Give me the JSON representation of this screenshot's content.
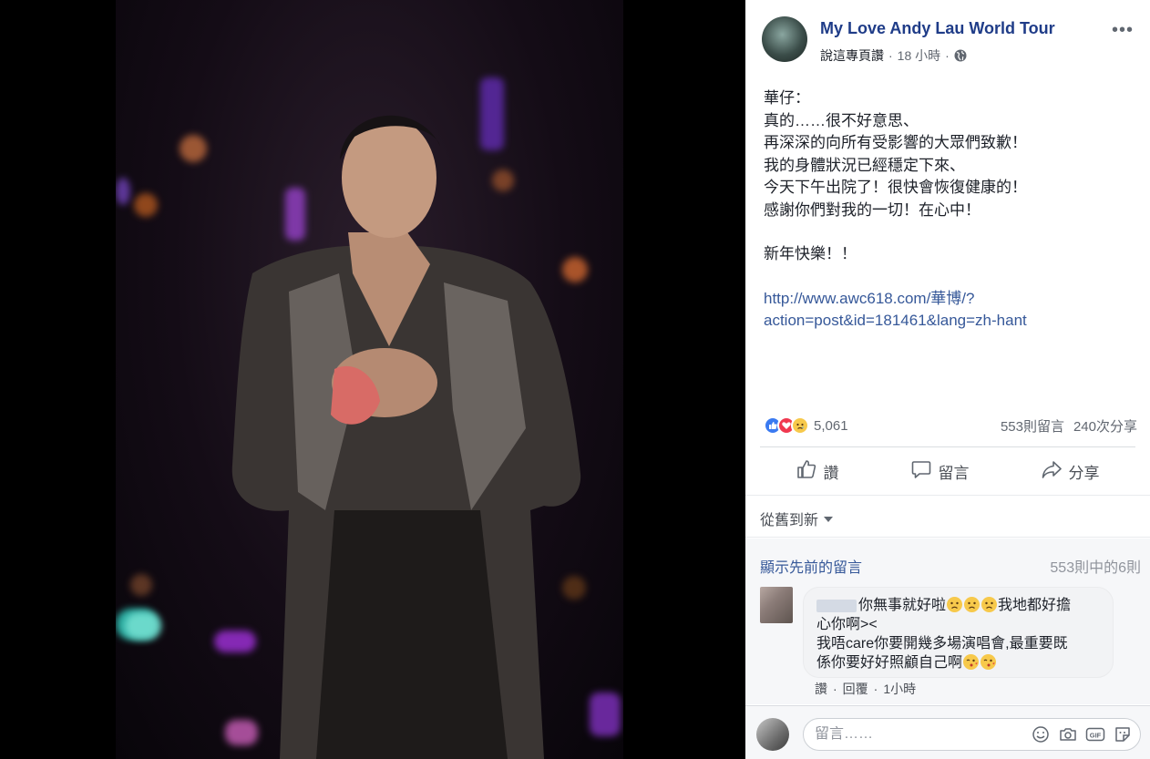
{
  "post": {
    "page_name": "My Love Andy Lau World Tour",
    "say_link": "說這專頁讚",
    "dot": "·",
    "time": "18 小時",
    "more": "•••",
    "lines": [
      "華仔：",
      "真的……很不好意思、",
      "再深深的向所有受影響的大眾們致歉！",
      "我的身體狀況已經穩定下來、",
      "今天下午出院了！很快會恢復健康的！",
      "感謝你們對我的一切！在心中！"
    ],
    "closing": "新年快樂！！",
    "link_line1": "http://www.awc618.com/華博/?",
    "link_line2": "action=post&id=181461&lang=zh-hant"
  },
  "stats": {
    "reaction_count": "5,061",
    "comments": "553則留言",
    "shares": "240次分享"
  },
  "actions": {
    "like": "讚",
    "comment": "留言",
    "share": "分享"
  },
  "comments": {
    "sort_label": "從舊到新",
    "show_previous": "顯示先前的留言",
    "count_of": "553則中的6則",
    "first": {
      "text1": "你無事就好啦",
      "text2": "我地都好擔",
      "text3": "心你啊><",
      "text4": "我唔care你要開幾多場演唱會,最重要既",
      "text5": "係你要好好照顧自己啊",
      "like": "讚",
      "reply": "回覆",
      "time": "1小時"
    }
  },
  "composer": {
    "placeholder": "留言……"
  },
  "colors": {
    "link": "#365899",
    "page_name": "#1f3c88",
    "like_blue": "#3a7af1",
    "love_red": "#f0384f",
    "emoji_yellow": "#f7c94b"
  }
}
